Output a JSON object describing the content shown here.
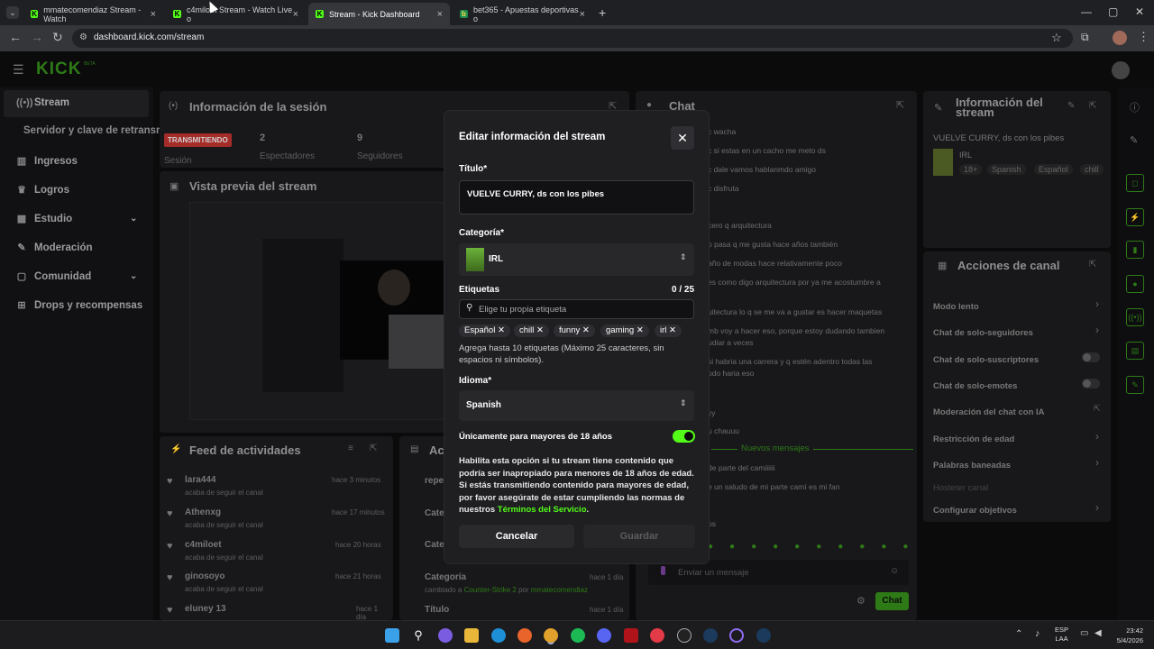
{
  "browser": {
    "tabs": [
      {
        "label": "mmatecomendiaz Stream - Watch",
        "favicon": "kick-logo-icon",
        "active": false
      },
      {
        "label": "c4miloet Stream - Watch Live o",
        "favicon": "kick-logo-icon",
        "active": false
      },
      {
        "label": "Stream - Kick Dashboard",
        "favicon": "kick-logo-icon",
        "active": true
      },
      {
        "label": "bet365 - Apuestas deportivas o",
        "favicon": "bet365-icon",
        "active": false
      }
    ],
    "url": "dashboard.kick.com/stream"
  },
  "header": {
    "logo": "KICK",
    "logo_sup": "BETA"
  },
  "sidebar": {
    "items": [
      {
        "label": "Stream",
        "icon": "broadcast-icon"
      },
      {
        "label": "Servidor y clave de retransm",
        "icon": ""
      },
      {
        "label": "Ingresos",
        "icon": "chart-icon"
      },
      {
        "label": "Logros",
        "icon": "trophy-icon"
      },
      {
        "label": "Estudio",
        "icon": "grid-icon"
      },
      {
        "label": "Moderación",
        "icon": "wrench-icon"
      },
      {
        "label": "Comunidad",
        "icon": "chat-icon"
      },
      {
        "label": "Drops y recompensas",
        "icon": "gift-icon"
      }
    ]
  },
  "session": {
    "title": "Información de la sesión",
    "live_badge": "TRANSMITIENDO",
    "stats": [
      {
        "value": "2",
        "label": "Espectadores"
      },
      {
        "value": "9",
        "label": "Seguidores"
      }
    ],
    "session_label": "Sesión"
  },
  "preview": {
    "title": "Vista previa del stream"
  },
  "feed": {
    "title": "Feed de actividades",
    "items": [
      {
        "user": "lara444",
        "time": "hace 3 minutos",
        "desc": "acaba de seguir el canal"
      },
      {
        "user": "Athenxg",
        "time": "hace 17 minutos",
        "desc": "acaba de seguir el canal"
      },
      {
        "user": "c4miloet",
        "time": "hace 20 horas",
        "desc": "acaba de seguir el canal"
      },
      {
        "user": "ginosoyo",
        "time": "hace 21 horas",
        "desc": "acaba de seguir el canal"
      },
      {
        "user": "eluney 13",
        "time": "hace 1 día",
        "desc": ""
      }
    ]
  },
  "actions_feed": {
    "title": "Ac",
    "items": [
      {
        "label": "repe",
        "time": ""
      },
      {
        "label": "Cate",
        "time": ""
      },
      {
        "label": "Cate",
        "time": ""
      },
      {
        "label": "Categoría",
        "time": "hace 1 día",
        "desc_prefix": "cambiado a",
        "desc_link": "Counter-Strike 2",
        "desc_mid": "por",
        "desc_user": "mmatecomendiaz"
      },
      {
        "label": "Título",
        "time": "hace 1 día"
      }
    ]
  },
  "chat": {
    "title": "Chat",
    "messages": [
      "c wacha",
      "c si estas en un cacho me meto ds",
      "c dale vamos hablanmdo amigo",
      "c disfruta",
      "cero q arquitectura",
      "o pasa q me gusta hace años también",
      "año de modas hace relativamente poco",
      "es como digo arquitectura por ya me acostumbre a",
      "uitectura lo q se me va a gustar es hacer maquetas",
      "mb voy a hacer eso, porque estoy dudando tambien",
      "udiar a veces",
      "si habria una carrera y q estén adentro todas las",
      "odo haria eso",
      "yy",
      "u chauuu",
      "de parte del camiiiiii",
      "e un saludo de mi parte camí es mi fan",
      "os"
    ],
    "new_messages": "Nuevos mensajes",
    "input_placeholder": "Enviar un mensaje",
    "send_label": "Chat"
  },
  "stream_info": {
    "title_line1": "Información del",
    "title_line2": "stream",
    "stream_title": "VUELVE CURRY, ds con los pibes",
    "category": "IRL",
    "tags": [
      "18+",
      "Spanish",
      "Español",
      "chill"
    ]
  },
  "channel_actions": {
    "title": "Acciones de canal",
    "items": [
      {
        "label": "Modo lento",
        "control": "chevron"
      },
      {
        "label": "Chat de solo-seguidores",
        "control": "chevron"
      },
      {
        "label": "Chat de solo-suscriptores",
        "control": "toggle"
      },
      {
        "label": "Chat de solo-emotes",
        "control": "toggle"
      },
      {
        "label": "Moderación del chat con IA",
        "control": "external"
      },
      {
        "label": "Restricción de edad",
        "control": "chevron"
      },
      {
        "label": "Palabras baneadas",
        "control": "chevron"
      },
      {
        "label": "Hosteter canal",
        "control": "none"
      },
      {
        "label": "Configurar objetivos",
        "control": "chevron"
      }
    ]
  },
  "modal": {
    "title": "Editar información del stream",
    "title_label": "Título*",
    "title_value": "VUELVE CURRY, ds con los pibes",
    "category_label": "Categoría*",
    "category_value": "IRL",
    "tags_label": "Etiquetas",
    "tags_count": "0 / 25",
    "tags_placeholder": "Elige tu propia etiqueta",
    "tags": [
      "Español",
      "chill",
      "funny",
      "gaming",
      "irl"
    ],
    "tags_help": "Agrega hasta 10 etiquetas (Máximo 25 caracteres, sin espacios ni símbolos).",
    "language_label": "Idioma*",
    "language_value": "Spanish",
    "mature_label": "Únicamente para mayores de 18 años",
    "mature_on": true,
    "mature_desc": "Habilita esta opción si tu stream tiene contenido que podría ser inapropiado para menores de 18 años de edad. Si estás transmitiendo contenido para mayores de edad, por favor asegúrate de estar cumpliendo las normas de nuestros",
    "terms_link": "Términos del Servicio",
    "terms_suffix": ".",
    "cancel_label": "Cancelar",
    "save_label": "Guardar"
  },
  "taskbar": {
    "lang_line1": "ESP",
    "lang_line2": "LAA",
    "time": "23:42",
    "date": "5/4/2026"
  },
  "colors": {
    "accent": "#53fc18",
    "bg": "#0b0b0c",
    "modal": "#1f1f22",
    "live": "#c8322d"
  }
}
